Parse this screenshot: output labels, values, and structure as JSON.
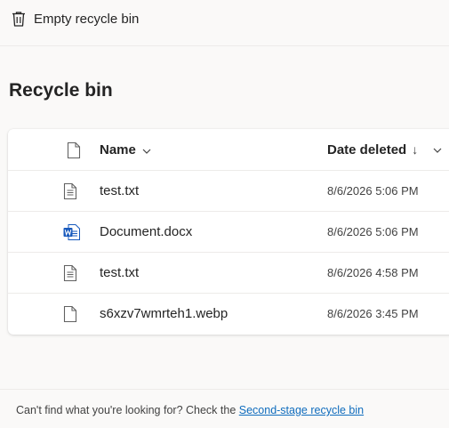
{
  "command_bar": {
    "empty_label": "Empty recycle bin",
    "icon": "trash-icon"
  },
  "page": {
    "title": "Recycle bin"
  },
  "table": {
    "columns": {
      "name": "Name",
      "date_deleted": "Date deleted",
      "sort_indicator": "↓"
    },
    "rows": [
      {
        "name": "test.txt",
        "date": "8/6/2026 5:06 PM",
        "icon": "text-file-icon"
      },
      {
        "name": "Document.docx",
        "date": "8/6/2026 5:06 PM",
        "icon": "word-document-icon"
      },
      {
        "name": "test.txt",
        "date": "8/6/2026 4:58 PM",
        "icon": "text-file-icon"
      },
      {
        "name": "s6xzv7wmrteh1.webp",
        "date": "8/6/2026 3:45 PM",
        "icon": "file-icon"
      }
    ]
  },
  "footer": {
    "text": "Can't find what you're looking for? Check the ",
    "link": "Second-stage recycle bin"
  },
  "colors": {
    "accent": "#0f6cbd",
    "word_blue": "#185abd",
    "background": "#faf9f8"
  }
}
